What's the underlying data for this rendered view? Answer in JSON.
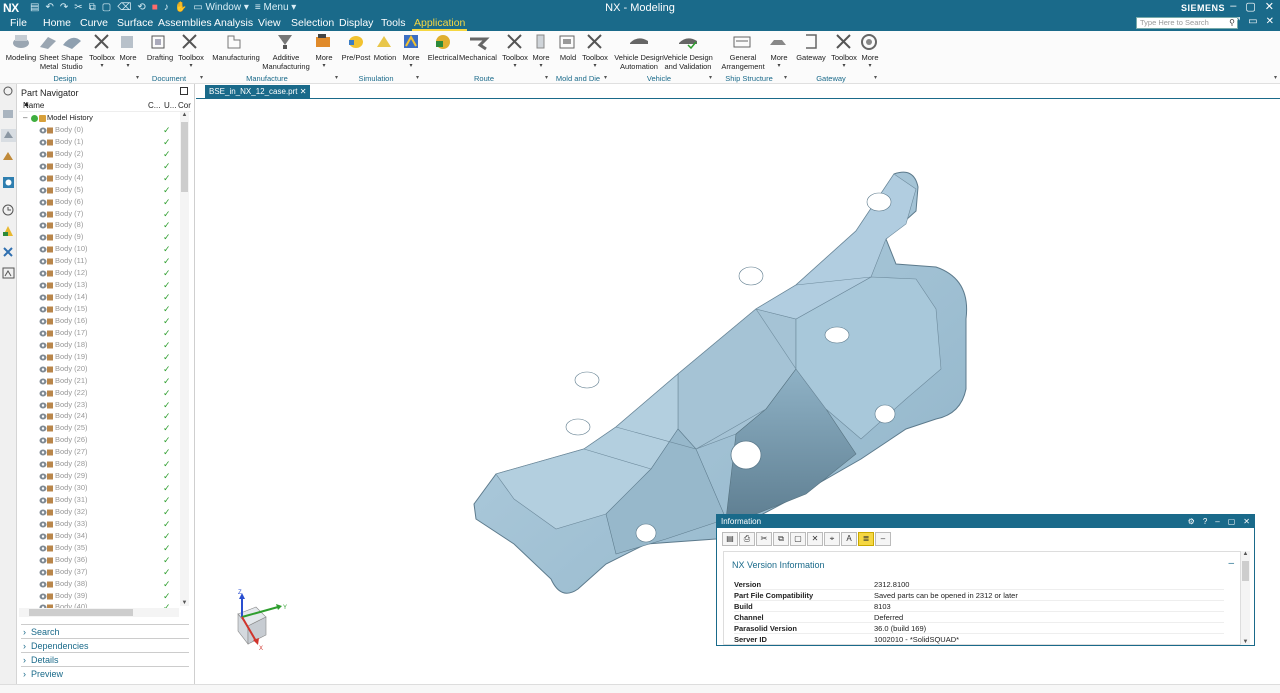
{
  "app": {
    "logo": "NX",
    "window_title": "NX - Modeling",
    "brand": "SIEMENS",
    "window_menu": "Window",
    "menu_menu": "Menu",
    "search_placeholder": "Type Here to Search"
  },
  "menubar": {
    "tabs": [
      "File",
      "Home",
      "Curve",
      "Surface",
      "Assemblies",
      "Analysis",
      "View",
      "Selection",
      "Display",
      "Tools",
      "Application"
    ],
    "active": "Application"
  },
  "ribbon": {
    "buttons": [
      {
        "label": "Modeling",
        "icon": "modeling-icon"
      },
      {
        "label": "Sheet Metal",
        "icon": "sheet-metal-icon"
      },
      {
        "label": "Shape Studio",
        "icon": "shape-studio-icon"
      },
      {
        "label": "Toolbox",
        "icon": "toolbox-icon"
      },
      {
        "label": "More",
        "icon": "more-icon"
      },
      {
        "label": "Drafting",
        "icon": "drafting-icon"
      },
      {
        "label": "Toolbox",
        "icon": "toolbox-icon"
      },
      {
        "label": "Manufacturing",
        "icon": "manufacturing-icon"
      },
      {
        "label": "Additive Manufacturing",
        "icon": "additive-manufacturing-icon"
      },
      {
        "label": "More",
        "icon": "more-icon"
      },
      {
        "label": "Pre/Post",
        "icon": "pre-post-icon"
      },
      {
        "label": "Motion",
        "icon": "motion-icon"
      },
      {
        "label": "More",
        "icon": "more-icon"
      },
      {
        "label": "Electrical",
        "icon": "electrical-icon"
      },
      {
        "label": "Mechanical",
        "icon": "mechanical-icon"
      },
      {
        "label": "Toolbox",
        "icon": "toolbox-icon"
      },
      {
        "label": "More",
        "icon": "more-icon"
      },
      {
        "label": "Mold",
        "icon": "mold-icon"
      },
      {
        "label": "Toolbox",
        "icon": "toolbox-icon"
      },
      {
        "label": "Vehicle Design Automation",
        "icon": "vehicle-design-automation-icon"
      },
      {
        "label": "Vehicle Design and Validation",
        "icon": "vehicle-design-validation-icon"
      },
      {
        "label": "General Arrangement",
        "icon": "general-arrangement-icon"
      },
      {
        "label": "More",
        "icon": "more-icon"
      },
      {
        "label": "Gateway",
        "icon": "gateway-icon"
      },
      {
        "label": "Toolbox",
        "icon": "toolbox-icon"
      },
      {
        "label": "More",
        "icon": "more-icon"
      }
    ],
    "groups": [
      "Design",
      "Document",
      "Manufacture",
      "Simulation",
      "Route",
      "Mold and Die",
      "Vehicle",
      "Ship Structure",
      "Gateway"
    ]
  },
  "part_navigator": {
    "title": "Part Navigator",
    "columns": {
      "name": "Name",
      "c": "C...",
      "u": "U...",
      "cor": "Cor"
    },
    "root": "Model History",
    "bodies": [
      "Body (0)",
      "Body (1)",
      "Body (2)",
      "Body (3)",
      "Body (4)",
      "Body (5)",
      "Body (6)",
      "Body (7)",
      "Body (8)",
      "Body (9)",
      "Body (10)",
      "Body (11)",
      "Body (12)",
      "Body (13)",
      "Body (14)",
      "Body (15)",
      "Body (16)",
      "Body (17)",
      "Body (18)",
      "Body (19)",
      "Body (20)",
      "Body (21)",
      "Body (22)",
      "Body (23)",
      "Body (24)",
      "Body (25)",
      "Body (26)",
      "Body (27)",
      "Body (28)",
      "Body (29)",
      "Body (30)",
      "Body (31)",
      "Body (32)",
      "Body (33)",
      "Body (34)",
      "Body (35)",
      "Body (36)",
      "Body (37)",
      "Body (38)",
      "Body (39)",
      "Body (40)"
    ],
    "panels": [
      "Search",
      "Dependencies",
      "Details",
      "Preview"
    ]
  },
  "document_tab": "BSE_in_NX_12_case.prt",
  "triad": {
    "x": "X",
    "y": "Y",
    "z": "Z"
  },
  "info_window": {
    "title": "Information",
    "heading": "NX Version Information",
    "rows": [
      {
        "key": "Version",
        "value": "2312.8100"
      },
      {
        "key": "Part File Compatibility",
        "value": "Saved parts can be opened in 2312 or later"
      },
      {
        "key": "Build",
        "value": "8103"
      },
      {
        "key": "Channel",
        "value": "Deferred"
      },
      {
        "key": "Parasolid Version",
        "value": "36.0 (build 169)"
      },
      {
        "key": "Server ID",
        "value": "1002010 - *SolidSQUAD*"
      }
    ]
  },
  "colors": {
    "titlebar": "#1a6a8a",
    "accent": "#f5d742",
    "part_fill": "#9fc2d6",
    "check": "#2e9e2e"
  }
}
